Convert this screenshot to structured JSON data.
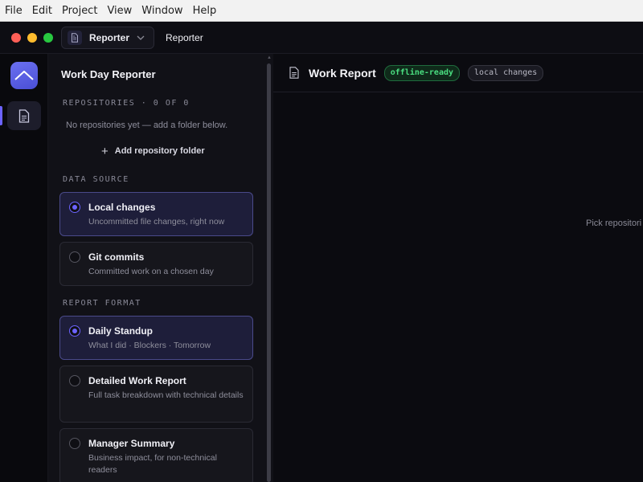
{
  "menubar": {
    "items": [
      "File",
      "Edit",
      "Project",
      "View",
      "Window",
      "Help"
    ]
  },
  "titlebar": {
    "app_switcher_label": "Reporter",
    "window_title": "Reporter"
  },
  "sidebar": {
    "title": "Work Day Reporter",
    "repositories": {
      "label": "REPOSITORIES · 0 OF 0",
      "empty_text": "No repositories yet — add a folder below.",
      "add_button": "Add repository folder"
    },
    "data_source": {
      "label": "DATA SOURCE",
      "options": [
        {
          "title": "Local changes",
          "desc": "Uncommitted file changes, right now",
          "selected": true
        },
        {
          "title": "Git commits",
          "desc": "Committed work on a chosen day",
          "selected": false
        }
      ]
    },
    "report_format": {
      "label": "REPORT FORMAT",
      "options": [
        {
          "title": "Daily Standup",
          "desc": "What I did · Blockers · Tomorrow",
          "selected": true
        },
        {
          "title": "Detailed Work Report",
          "desc": "Full task breakdown with technical details",
          "selected": false
        },
        {
          "title": "Manager Summary",
          "desc": "Business impact, for non-technical readers",
          "selected": false
        }
      ]
    }
  },
  "main": {
    "title": "Work Report",
    "badges": [
      "offline-ready",
      "local changes"
    ],
    "placeholder": "Pick repositori"
  },
  "colors": {
    "accent": "#6c63ff",
    "offline_badge": "#4ade80",
    "traffic_red": "#fe5f57",
    "traffic_yellow": "#febc2e",
    "traffic_green": "#28c840"
  }
}
